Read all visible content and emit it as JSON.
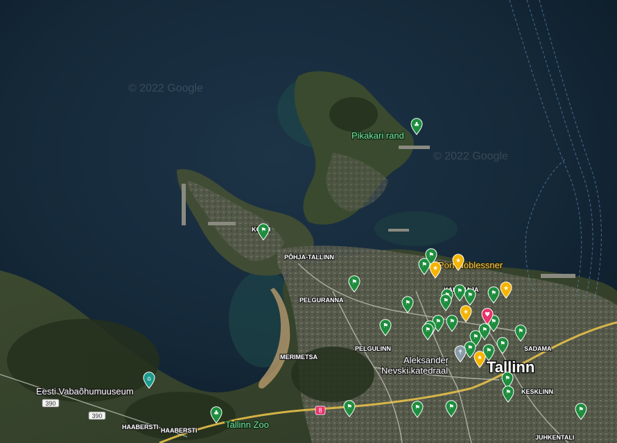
{
  "map": {
    "watermarks": [
      "© 2022 Google",
      "© 2022 Google"
    ],
    "places": [
      {
        "name": "Pikakari rand",
        "style": "poi-green",
        "size": 13
      },
      {
        "name": "Port Noblessner",
        "style": "poi-yellow",
        "size": 13
      },
      {
        "name": "Eesti Vabaõhumuuseum",
        "style": "poi-white",
        "size": 13
      },
      {
        "name": "Tallinn Zoo",
        "style": "poi-green",
        "size": 13
      },
      {
        "name": "Aleksander",
        "style": "poi-white",
        "size": 13
      },
      {
        "name": "Nevski katedraal",
        "style": "poi-white",
        "size": 13
      }
    ],
    "districts": [
      "KOPLI",
      "PÕHJA-TALLINN",
      "KALAMAJA",
      "PELGURANNA",
      "PELGULINN",
      "MERIMETSA",
      "SADAMA",
      "KESKLINN",
      "HAABERSTI",
      "HAABERSTI",
      "JUHKENTALI"
    ],
    "city": "Tallinn",
    "roads": [
      "390",
      "390",
      "8"
    ],
    "colors": {
      "green_pin": "#1e8e3e",
      "yellow_pin": "#f4b400",
      "red_pin": "#e8336b",
      "gray_pin": "#8a9ba8",
      "teal_pin": "#1a9a8c"
    },
    "pins": [
      {
        "type": "green",
        "icon": "flag-icon"
      },
      {
        "type": "green",
        "icon": "park-icon"
      },
      {
        "type": "green",
        "icon": "park-icon"
      },
      {
        "type": "teal",
        "icon": "museum-icon"
      },
      {
        "type": "green",
        "icon": "flag-icon"
      },
      {
        "type": "green",
        "icon": "flag-icon"
      },
      {
        "type": "green",
        "icon": "flag-icon"
      },
      {
        "type": "green",
        "icon": "flag-icon"
      },
      {
        "type": "green",
        "icon": "flag-icon"
      },
      {
        "type": "yellow",
        "icon": "star-icon"
      },
      {
        "type": "yellow",
        "icon": "star-icon"
      },
      {
        "type": "yellow",
        "icon": "star-icon"
      },
      {
        "type": "yellow",
        "icon": "star-icon"
      },
      {
        "type": "yellow",
        "icon": "star-icon"
      },
      {
        "type": "red",
        "icon": "heart-icon"
      },
      {
        "type": "gray",
        "icon": "cross-icon"
      }
    ]
  }
}
